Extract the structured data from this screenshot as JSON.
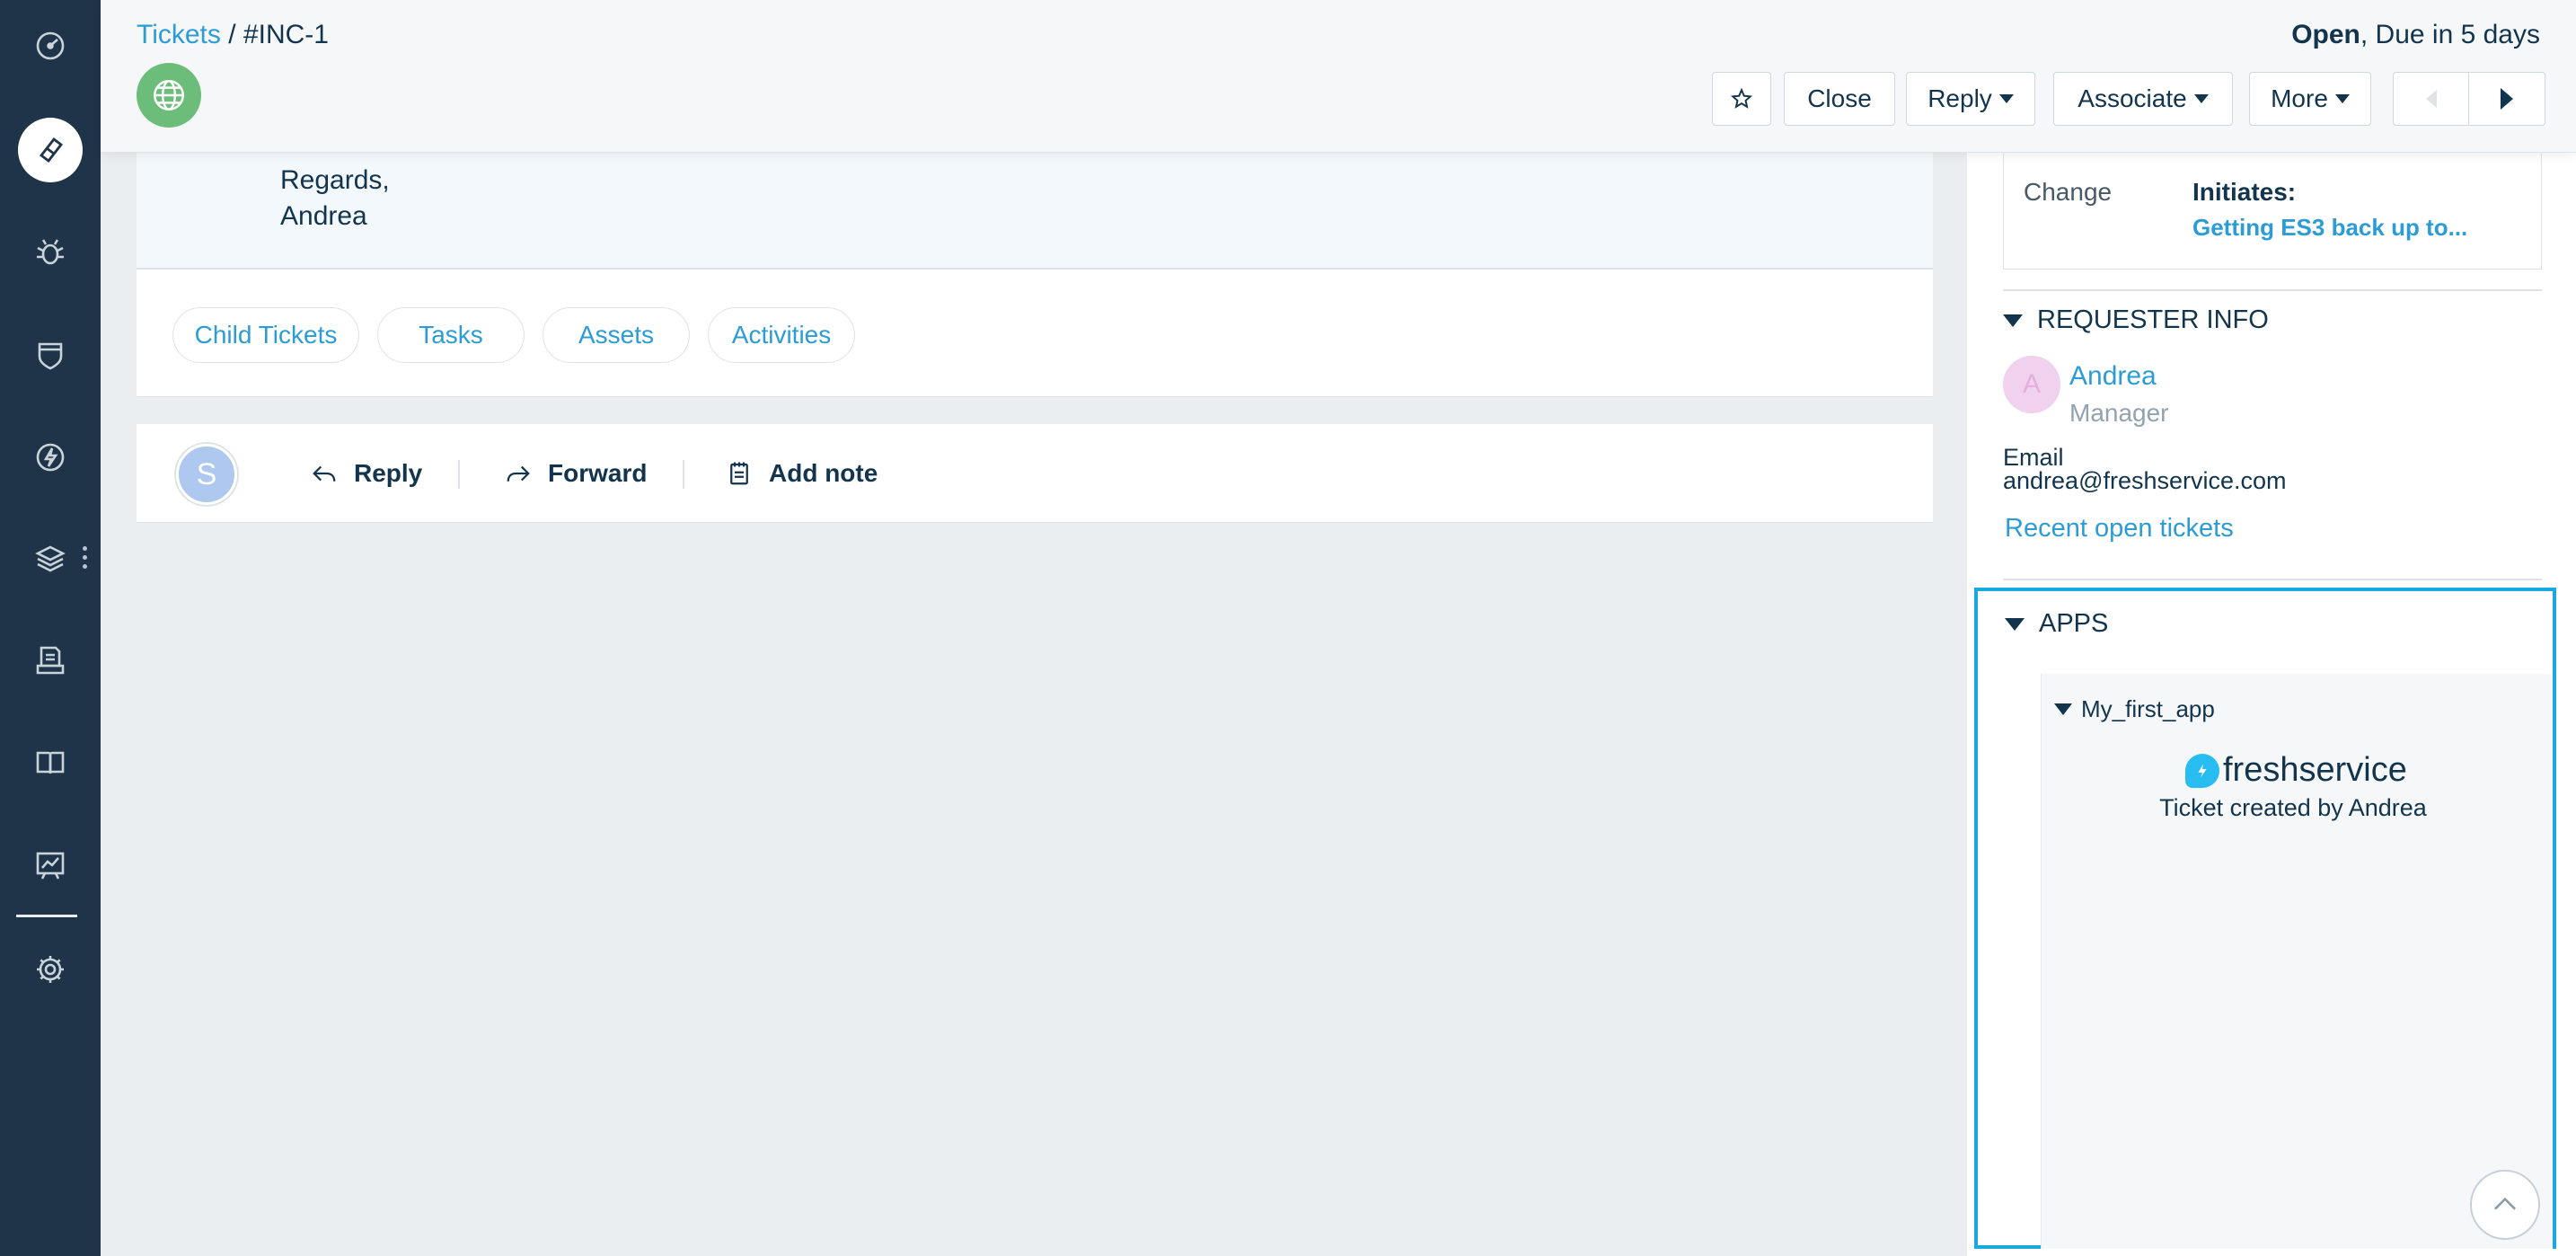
{
  "header": {
    "breadcrumb_link": "Tickets",
    "breadcrumb_sep": " / ",
    "breadcrumb_current": "#INC-1",
    "status_state": "Open",
    "status_due": ", Due in 5 days",
    "buttons": {
      "close": "Close",
      "reply": "Reply",
      "associate": "Associate",
      "more": "More"
    }
  },
  "email_tail": {
    "line1": "Regards,",
    "line2": "Andrea"
  },
  "tabs": [
    "Child Tickets",
    "Tasks",
    "Assets",
    "Activities"
  ],
  "reply_bar": {
    "avatar_initial": "S",
    "reply": "Reply",
    "forward": "Forward",
    "add_note": "Add note"
  },
  "associations": {
    "change_label": "Change",
    "change_relation": "Initiates:",
    "change_link": "Getting ES3 back up to..."
  },
  "requester": {
    "section_title": "REQUESTER INFO",
    "avatar_initial": "A",
    "name": "Andrea",
    "role": "Manager",
    "email_label": "Email",
    "email": "andrea@freshservice.com",
    "recent_link": "Recent open tickets"
  },
  "apps": {
    "section_title": "APPS",
    "app_name": "My_first_app",
    "logo_text": "freshservice",
    "message": "Ticket created by Andrea"
  },
  "colors": {
    "nav_bg": "#1f3448",
    "link": "#2c9cd6",
    "highlight_border": "#1aa8e0"
  }
}
